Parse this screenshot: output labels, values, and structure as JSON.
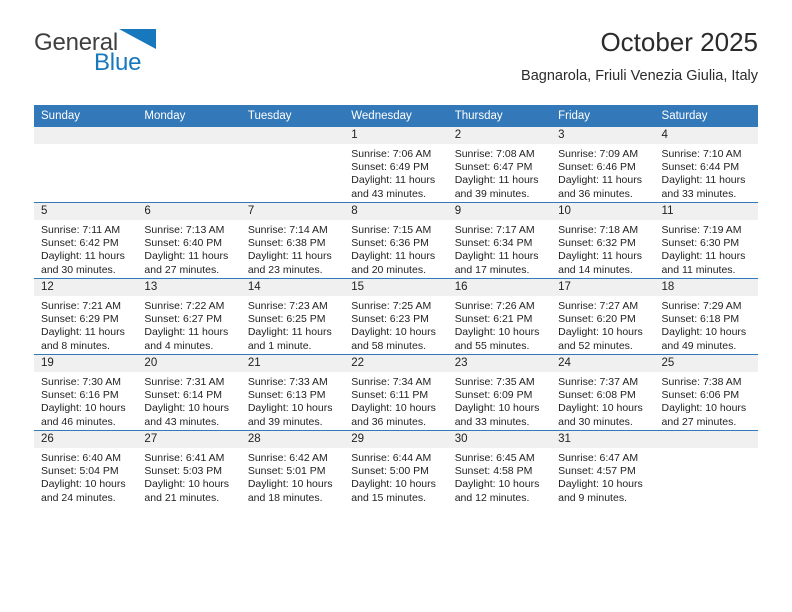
{
  "brand": {
    "name_top": "General",
    "name_bottom": "Blue",
    "top_color": "#3f3f3f",
    "accent_color": "#1878be"
  },
  "header": {
    "title": "October 2025",
    "subtitle": "Bagnarola, Friuli Venezia Giulia, Italy"
  },
  "theme": {
    "header_blue": "#3378b8",
    "band_gray": "#f0f0f0"
  },
  "weekday_headers": [
    "Sunday",
    "Monday",
    "Tuesday",
    "Wednesday",
    "Thursday",
    "Friday",
    "Saturday"
  ],
  "weeks": [
    [
      {
        "day": "",
        "sunrise": "",
        "sunset": "",
        "daylight_line1": "",
        "daylight_line2": ""
      },
      {
        "day": "",
        "sunrise": "",
        "sunset": "",
        "daylight_line1": "",
        "daylight_line2": ""
      },
      {
        "day": "",
        "sunrise": "",
        "sunset": "",
        "daylight_line1": "",
        "daylight_line2": ""
      },
      {
        "day": "1",
        "sunrise": "Sunrise: 7:06 AM",
        "sunset": "Sunset: 6:49 PM",
        "daylight_line1": "Daylight: 11 hours",
        "daylight_line2": "and 43 minutes."
      },
      {
        "day": "2",
        "sunrise": "Sunrise: 7:08 AM",
        "sunset": "Sunset: 6:47 PM",
        "daylight_line1": "Daylight: 11 hours",
        "daylight_line2": "and 39 minutes."
      },
      {
        "day": "3",
        "sunrise": "Sunrise: 7:09 AM",
        "sunset": "Sunset: 6:46 PM",
        "daylight_line1": "Daylight: 11 hours",
        "daylight_line2": "and 36 minutes."
      },
      {
        "day": "4",
        "sunrise": "Sunrise: 7:10 AM",
        "sunset": "Sunset: 6:44 PM",
        "daylight_line1": "Daylight: 11 hours",
        "daylight_line2": "and 33 minutes."
      }
    ],
    [
      {
        "day": "5",
        "sunrise": "Sunrise: 7:11 AM",
        "sunset": "Sunset: 6:42 PM",
        "daylight_line1": "Daylight: 11 hours",
        "daylight_line2": "and 30 minutes."
      },
      {
        "day": "6",
        "sunrise": "Sunrise: 7:13 AM",
        "sunset": "Sunset: 6:40 PM",
        "daylight_line1": "Daylight: 11 hours",
        "daylight_line2": "and 27 minutes."
      },
      {
        "day": "7",
        "sunrise": "Sunrise: 7:14 AM",
        "sunset": "Sunset: 6:38 PM",
        "daylight_line1": "Daylight: 11 hours",
        "daylight_line2": "and 23 minutes."
      },
      {
        "day": "8",
        "sunrise": "Sunrise: 7:15 AM",
        "sunset": "Sunset: 6:36 PM",
        "daylight_line1": "Daylight: 11 hours",
        "daylight_line2": "and 20 minutes."
      },
      {
        "day": "9",
        "sunrise": "Sunrise: 7:17 AM",
        "sunset": "Sunset: 6:34 PM",
        "daylight_line1": "Daylight: 11 hours",
        "daylight_line2": "and 17 minutes."
      },
      {
        "day": "10",
        "sunrise": "Sunrise: 7:18 AM",
        "sunset": "Sunset: 6:32 PM",
        "daylight_line1": "Daylight: 11 hours",
        "daylight_line2": "and 14 minutes."
      },
      {
        "day": "11",
        "sunrise": "Sunrise: 7:19 AM",
        "sunset": "Sunset: 6:30 PM",
        "daylight_line1": "Daylight: 11 hours",
        "daylight_line2": "and 11 minutes."
      }
    ],
    [
      {
        "day": "12",
        "sunrise": "Sunrise: 7:21 AM",
        "sunset": "Sunset: 6:29 PM",
        "daylight_line1": "Daylight: 11 hours",
        "daylight_line2": "and 8 minutes."
      },
      {
        "day": "13",
        "sunrise": "Sunrise: 7:22 AM",
        "sunset": "Sunset: 6:27 PM",
        "daylight_line1": "Daylight: 11 hours",
        "daylight_line2": "and 4 minutes."
      },
      {
        "day": "14",
        "sunrise": "Sunrise: 7:23 AM",
        "sunset": "Sunset: 6:25 PM",
        "daylight_line1": "Daylight: 11 hours",
        "daylight_line2": "and 1 minute."
      },
      {
        "day": "15",
        "sunrise": "Sunrise: 7:25 AM",
        "sunset": "Sunset: 6:23 PM",
        "daylight_line1": "Daylight: 10 hours",
        "daylight_line2": "and 58 minutes."
      },
      {
        "day": "16",
        "sunrise": "Sunrise: 7:26 AM",
        "sunset": "Sunset: 6:21 PM",
        "daylight_line1": "Daylight: 10 hours",
        "daylight_line2": "and 55 minutes."
      },
      {
        "day": "17",
        "sunrise": "Sunrise: 7:27 AM",
        "sunset": "Sunset: 6:20 PM",
        "daylight_line1": "Daylight: 10 hours",
        "daylight_line2": "and 52 minutes."
      },
      {
        "day": "18",
        "sunrise": "Sunrise: 7:29 AM",
        "sunset": "Sunset: 6:18 PM",
        "daylight_line1": "Daylight: 10 hours",
        "daylight_line2": "and 49 minutes."
      }
    ],
    [
      {
        "day": "19",
        "sunrise": "Sunrise: 7:30 AM",
        "sunset": "Sunset: 6:16 PM",
        "daylight_line1": "Daylight: 10 hours",
        "daylight_line2": "and 46 minutes."
      },
      {
        "day": "20",
        "sunrise": "Sunrise: 7:31 AM",
        "sunset": "Sunset: 6:14 PM",
        "daylight_line1": "Daylight: 10 hours",
        "daylight_line2": "and 43 minutes."
      },
      {
        "day": "21",
        "sunrise": "Sunrise: 7:33 AM",
        "sunset": "Sunset: 6:13 PM",
        "daylight_line1": "Daylight: 10 hours",
        "daylight_line2": "and 39 minutes."
      },
      {
        "day": "22",
        "sunrise": "Sunrise: 7:34 AM",
        "sunset": "Sunset: 6:11 PM",
        "daylight_line1": "Daylight: 10 hours",
        "daylight_line2": "and 36 minutes."
      },
      {
        "day": "23",
        "sunrise": "Sunrise: 7:35 AM",
        "sunset": "Sunset: 6:09 PM",
        "daylight_line1": "Daylight: 10 hours",
        "daylight_line2": "and 33 minutes."
      },
      {
        "day": "24",
        "sunrise": "Sunrise: 7:37 AM",
        "sunset": "Sunset: 6:08 PM",
        "daylight_line1": "Daylight: 10 hours",
        "daylight_line2": "and 30 minutes."
      },
      {
        "day": "25",
        "sunrise": "Sunrise: 7:38 AM",
        "sunset": "Sunset: 6:06 PM",
        "daylight_line1": "Daylight: 10 hours",
        "daylight_line2": "and 27 minutes."
      }
    ],
    [
      {
        "day": "26",
        "sunrise": "Sunrise: 6:40 AM",
        "sunset": "Sunset: 5:04 PM",
        "daylight_line1": "Daylight: 10 hours",
        "daylight_line2": "and 24 minutes."
      },
      {
        "day": "27",
        "sunrise": "Sunrise: 6:41 AM",
        "sunset": "Sunset: 5:03 PM",
        "daylight_line1": "Daylight: 10 hours",
        "daylight_line2": "and 21 minutes."
      },
      {
        "day": "28",
        "sunrise": "Sunrise: 6:42 AM",
        "sunset": "Sunset: 5:01 PM",
        "daylight_line1": "Daylight: 10 hours",
        "daylight_line2": "and 18 minutes."
      },
      {
        "day": "29",
        "sunrise": "Sunrise: 6:44 AM",
        "sunset": "Sunset: 5:00 PM",
        "daylight_line1": "Daylight: 10 hours",
        "daylight_line2": "and 15 minutes."
      },
      {
        "day": "30",
        "sunrise": "Sunrise: 6:45 AM",
        "sunset": "Sunset: 4:58 PM",
        "daylight_line1": "Daylight: 10 hours",
        "daylight_line2": "and 12 minutes."
      },
      {
        "day": "31",
        "sunrise": "Sunrise: 6:47 AM",
        "sunset": "Sunset: 4:57 PM",
        "daylight_line1": "Daylight: 10 hours",
        "daylight_line2": "and 9 minutes."
      },
      {
        "day": "",
        "sunrise": "",
        "sunset": "",
        "daylight_line1": "",
        "daylight_line2": ""
      }
    ]
  ]
}
